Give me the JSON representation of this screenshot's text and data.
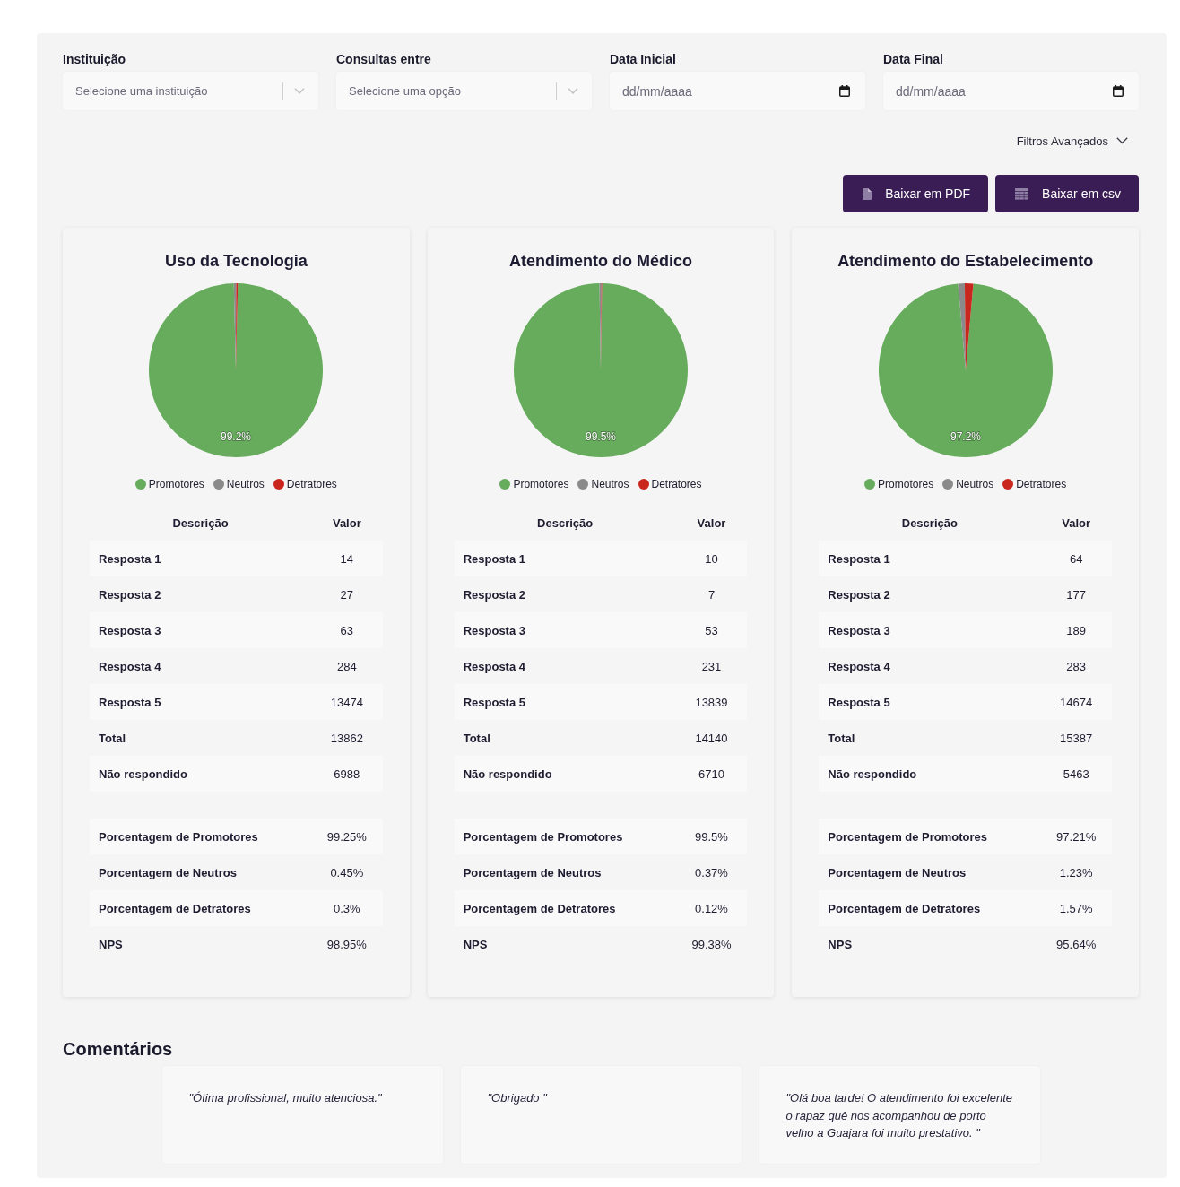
{
  "filters": [
    {
      "kind": "select",
      "label": "Instituição",
      "placeholder": "Selecione uma instituição"
    },
    {
      "kind": "select",
      "label": "Consultas entre",
      "placeholder": "Selecione uma opção"
    },
    {
      "kind": "date",
      "label": "Data Inicial",
      "placeholder": "dd/mm/aaaa"
    },
    {
      "kind": "date",
      "label": "Data Final",
      "placeholder": "dd/mm/aaaa"
    }
  ],
  "advanced_filters": {
    "label": "Filtros Avançados",
    "expanded": false
  },
  "export_buttons": [
    {
      "kind": "pdf",
      "label": "Baixar em PDF"
    },
    {
      "kind": "csv",
      "label": "Baixar em csv"
    }
  ],
  "cards": [
    {
      "chart_data": {
        "type": "pie",
        "title": "Uso da Tecnologia",
        "categories": [
          "Promotores",
          "Neutros",
          "Detratores"
        ],
        "values": [
          99.25,
          0.45,
          0.3
        ],
        "colors": [
          "#66ac5c",
          "#8a8a8a",
          "#c9261d"
        ],
        "legend": "bottom",
        "value_labels": [
          "99.2%",
          null,
          null
        ]
      },
      "table": {
        "columns": [
          "Descrição",
          "Valor"
        ],
        "rows": [
          [
            "Resposta 1",
            "14"
          ],
          [
            "Resposta 2",
            "27"
          ],
          [
            "Resposta 3",
            "63"
          ],
          [
            "Resposta 4",
            "284"
          ],
          [
            "Resposta 5",
            "13474"
          ],
          [
            "Total",
            "13862"
          ],
          [
            "Não respondido",
            "6988"
          ]
        ]
      },
      "summary_rows": [
        [
          "Porcentagem de Promotores",
          "99.25%"
        ],
        [
          "Porcentagem de Neutros",
          "0.45%"
        ],
        [
          "Porcentagem de Detratores",
          "0.3%"
        ],
        [
          "NPS",
          "98.95%"
        ]
      ]
    },
    {
      "chart_data": {
        "type": "pie",
        "title": "Atendimento do Médico",
        "categories": [
          "Promotores",
          "Neutros",
          "Detratores"
        ],
        "values": [
          99.5,
          0.37,
          0.12
        ],
        "colors": [
          "#66ac5c",
          "#8a8a8a",
          "#c9261d"
        ],
        "legend": "bottom",
        "value_labels": [
          "99.5%",
          null,
          null
        ]
      },
      "table": {
        "columns": [
          "Descrição",
          "Valor"
        ],
        "rows": [
          [
            "Resposta 1",
            "10"
          ],
          [
            "Resposta 2",
            "7"
          ],
          [
            "Resposta 3",
            "53"
          ],
          [
            "Resposta 4",
            "231"
          ],
          [
            "Resposta 5",
            "13839"
          ],
          [
            "Total",
            "14140"
          ],
          [
            "Não respondido",
            "6710"
          ]
        ]
      },
      "summary_rows": [
        [
          "Porcentagem de Promotores",
          "99.5%"
        ],
        [
          "Porcentagem de Neutros",
          "0.37%"
        ],
        [
          "Porcentagem de Detratores",
          "0.12%"
        ],
        [
          "NPS",
          "99.38%"
        ]
      ]
    },
    {
      "chart_data": {
        "type": "pie",
        "title": "Atendimento do Estabelecimento",
        "categories": [
          "Promotores",
          "Neutros",
          "Detratores"
        ],
        "values": [
          97.21,
          1.23,
          1.57
        ],
        "colors": [
          "#66ac5c",
          "#8a8a8a",
          "#c9261d"
        ],
        "legend": "bottom",
        "value_labels": [
          "97.2%",
          null,
          null
        ]
      },
      "table": {
        "columns": [
          "Descrição",
          "Valor"
        ],
        "rows": [
          [
            "Resposta 1",
            "64"
          ],
          [
            "Resposta 2",
            "177"
          ],
          [
            "Resposta 3",
            "189"
          ],
          [
            "Resposta 4",
            "283"
          ],
          [
            "Resposta 5",
            "14674"
          ],
          [
            "Total",
            "15387"
          ],
          [
            "Não respondido",
            "5463"
          ]
        ]
      },
      "summary_rows": [
        [
          "Porcentagem de Promotores",
          "97.21%"
        ],
        [
          "Porcentagem de Neutros",
          "1.23%"
        ],
        [
          "Porcentagem de Detratores",
          "1.57%"
        ],
        [
          "NPS",
          "95.64%"
        ]
      ]
    }
  ],
  "comments": {
    "title": "Comentários",
    "items": [
      "\"Ótima profissional, muito atenciosa.\"",
      "\"Obrigado \"",
      "\"Olá boa tarde! O atendimento foi excelente o rapaz quê nos acompanhou de porto velho a Guajara foi muito prestativo. \""
    ]
  }
}
